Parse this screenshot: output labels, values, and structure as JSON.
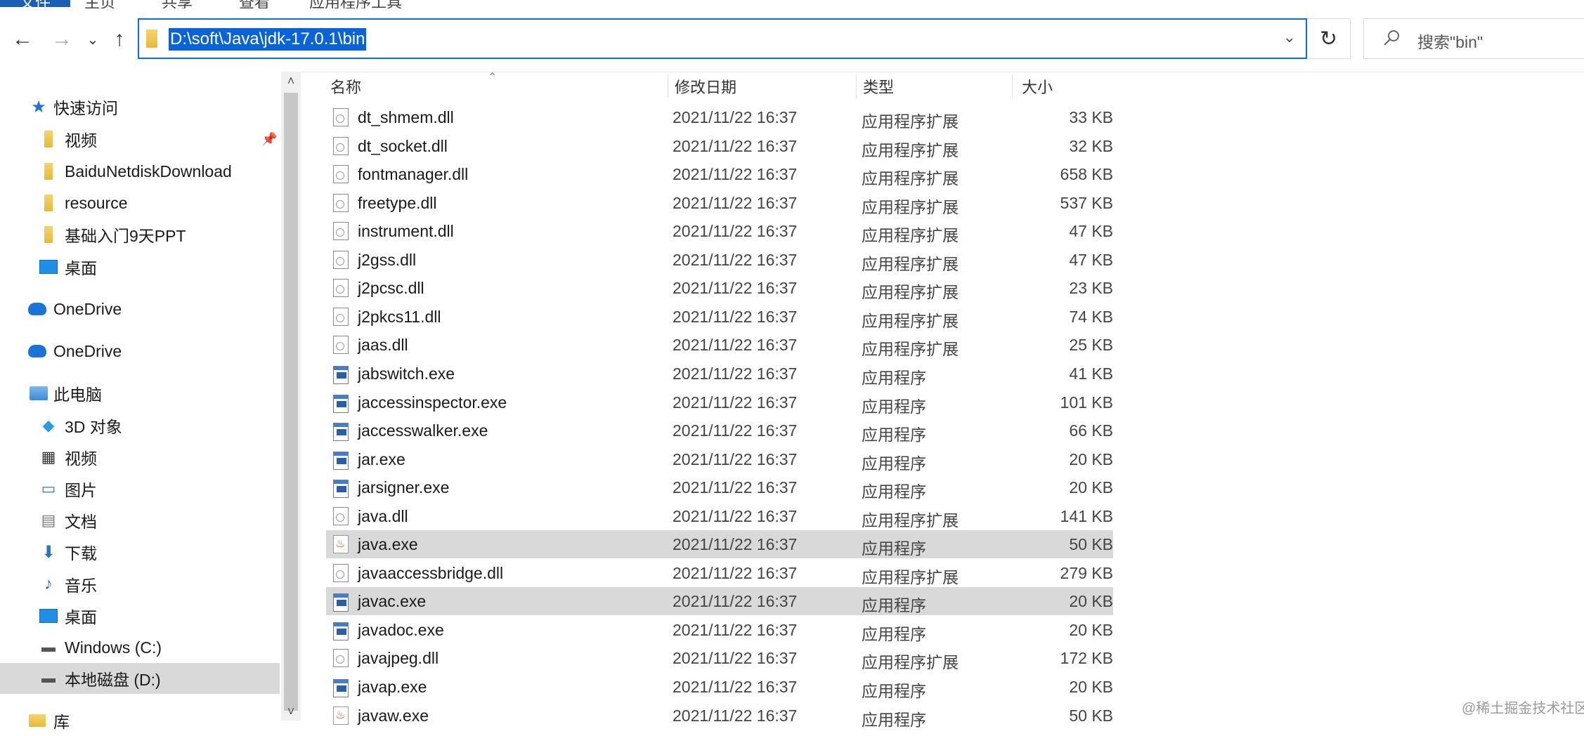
{
  "ribbon": {
    "tabs": [
      "文件",
      "主页",
      "共享",
      "查看",
      "应用程序工具"
    ]
  },
  "nav": {
    "back_icon": "arrow-left-icon",
    "forward_icon": "arrow-right-icon",
    "recent_icon": "chevron-down-icon",
    "up_icon": "arrow-up-icon"
  },
  "address": {
    "path": "D:\\soft\\Java\\jdk-17.0.1\\bin"
  },
  "search": {
    "placeholder": "搜索\"bin\""
  },
  "sidebar": {
    "items": [
      {
        "label": "快速访问",
        "icon": "star-icon"
      },
      {
        "label": "视频",
        "icon": "folder-icon",
        "pinned": true
      },
      {
        "label": "BaiduNetdiskDownload",
        "icon": "folder-icon"
      },
      {
        "label": "resource",
        "icon": "folder-icon"
      },
      {
        "label": "基础入门9天PPT",
        "icon": "folder-icon"
      },
      {
        "label": "桌面",
        "icon": "desktop-icon"
      },
      {
        "label": "OneDrive",
        "icon": "cloud-icon"
      },
      {
        "label": "OneDrive",
        "icon": "cloud-icon"
      },
      {
        "label": "此电脑",
        "icon": "computer-icon"
      },
      {
        "label": "3D 对象",
        "icon": "cube-icon"
      },
      {
        "label": "视频",
        "icon": "video-icon"
      },
      {
        "label": "图片",
        "icon": "picture-icon"
      },
      {
        "label": "文档",
        "icon": "document-icon"
      },
      {
        "label": "下载",
        "icon": "download-icon"
      },
      {
        "label": "音乐",
        "icon": "music-icon"
      },
      {
        "label": "桌面",
        "icon": "desktop-icon"
      },
      {
        "label": "Windows (C:)",
        "icon": "drive-icon"
      },
      {
        "label": "本地磁盘 (D:)",
        "icon": "drive-icon",
        "selected": true
      },
      {
        "label": "库",
        "icon": "library-icon"
      }
    ]
  },
  "table": {
    "headers": {
      "name": "名称",
      "modified": "修改日期",
      "type": "类型",
      "size": "大小"
    },
    "rows": [
      {
        "name": "dt_shmem.dll",
        "modified": "2021/11/22 16:37",
        "type": "应用程序扩展",
        "size": "33 KB",
        "icon": "dll-icon"
      },
      {
        "name": "dt_socket.dll",
        "modified": "2021/11/22 16:37",
        "type": "应用程序扩展",
        "size": "32 KB",
        "icon": "dll-icon"
      },
      {
        "name": "fontmanager.dll",
        "modified": "2021/11/22 16:37",
        "type": "应用程序扩展",
        "size": "658 KB",
        "icon": "dll-icon"
      },
      {
        "name": "freetype.dll",
        "modified": "2021/11/22 16:37",
        "type": "应用程序扩展",
        "size": "537 KB",
        "icon": "dll-icon"
      },
      {
        "name": "instrument.dll",
        "modified": "2021/11/22 16:37",
        "type": "应用程序扩展",
        "size": "47 KB",
        "icon": "dll-icon"
      },
      {
        "name": "j2gss.dll",
        "modified": "2021/11/22 16:37",
        "type": "应用程序扩展",
        "size": "47 KB",
        "icon": "dll-icon"
      },
      {
        "name": "j2pcsc.dll",
        "modified": "2021/11/22 16:37",
        "type": "应用程序扩展",
        "size": "23 KB",
        "icon": "dll-icon"
      },
      {
        "name": "j2pkcs11.dll",
        "modified": "2021/11/22 16:37",
        "type": "应用程序扩展",
        "size": "74 KB",
        "icon": "dll-icon"
      },
      {
        "name": "jaas.dll",
        "modified": "2021/11/22 16:37",
        "type": "应用程序扩展",
        "size": "25 KB",
        "icon": "dll-icon"
      },
      {
        "name": "jabswitch.exe",
        "modified": "2021/11/22 16:37",
        "type": "应用程序",
        "size": "41 KB",
        "icon": "exe-icon"
      },
      {
        "name": "jaccessinspector.exe",
        "modified": "2021/11/22 16:37",
        "type": "应用程序",
        "size": "101 KB",
        "icon": "exe-icon"
      },
      {
        "name": "jaccesswalker.exe",
        "modified": "2021/11/22 16:37",
        "type": "应用程序",
        "size": "66 KB",
        "icon": "exe-icon"
      },
      {
        "name": "jar.exe",
        "modified": "2021/11/22 16:37",
        "type": "应用程序",
        "size": "20 KB",
        "icon": "exe-icon"
      },
      {
        "name": "jarsigner.exe",
        "modified": "2021/11/22 16:37",
        "type": "应用程序",
        "size": "20 KB",
        "icon": "exe-icon"
      },
      {
        "name": "java.dll",
        "modified": "2021/11/22 16:37",
        "type": "应用程序扩展",
        "size": "141 KB",
        "icon": "dll-icon"
      },
      {
        "name": "java.exe",
        "modified": "2021/11/22 16:37",
        "type": "应用程序",
        "size": "50 KB",
        "icon": "java-icon",
        "highlighted": true
      },
      {
        "name": "javaaccessbridge.dll",
        "modified": "2021/11/22 16:37",
        "type": "应用程序扩展",
        "size": "279 KB",
        "icon": "dll-icon"
      },
      {
        "name": "javac.exe",
        "modified": "2021/11/22 16:37",
        "type": "应用程序",
        "size": "20 KB",
        "icon": "exe-icon",
        "highlighted": true
      },
      {
        "name": "javadoc.exe",
        "modified": "2021/11/22 16:37",
        "type": "应用程序",
        "size": "20 KB",
        "icon": "exe-icon"
      },
      {
        "name": "javajpeg.dll",
        "modified": "2021/11/22 16:37",
        "type": "应用程序扩展",
        "size": "172 KB",
        "icon": "dll-icon"
      },
      {
        "name": "javap.exe",
        "modified": "2021/11/22 16:37",
        "type": "应用程序",
        "size": "20 KB",
        "icon": "exe-icon"
      },
      {
        "name": "javaw.exe",
        "modified": "2021/11/22 16:37",
        "type": "应用程序",
        "size": "50 KB",
        "icon": "java-icon"
      }
    ]
  },
  "watermark": "@稀土掘金技术社区",
  "colors": {
    "accent": "#0a64d8",
    "selection": "#d9d9d9",
    "folder": "#e8b93a"
  }
}
